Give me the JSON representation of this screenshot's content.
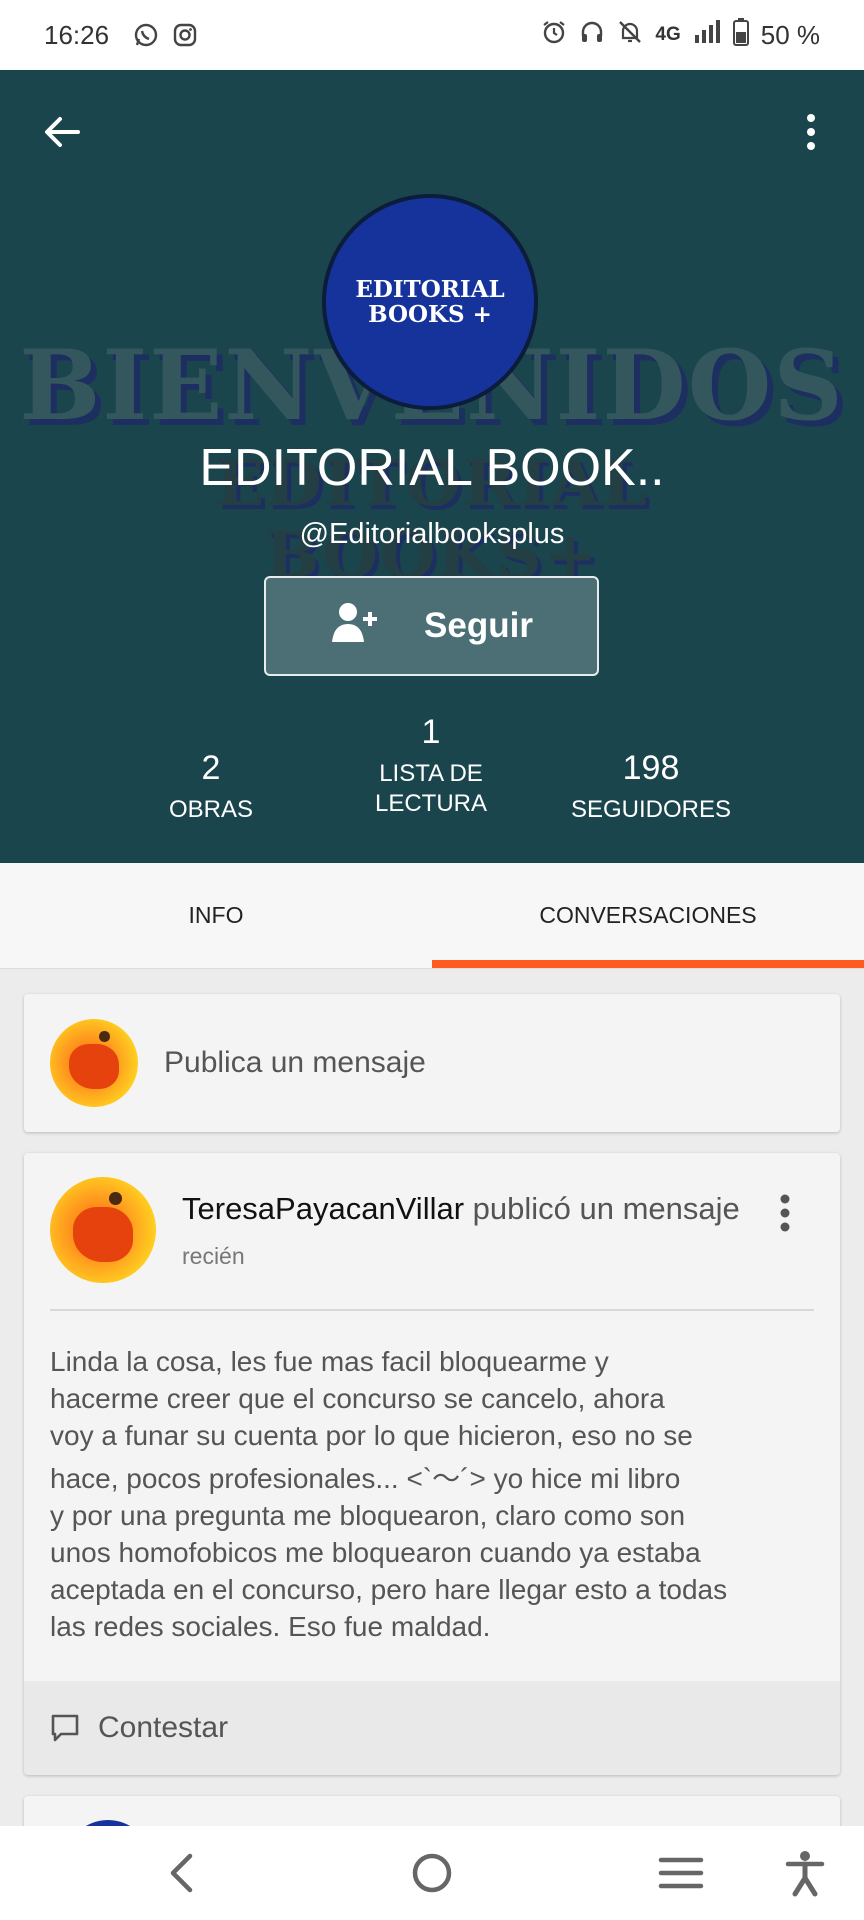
{
  "status_bar": {
    "time": "16:26",
    "network": "4G",
    "battery": "50 %",
    "left_icons": [
      "whatsapp-icon",
      "instagram-icon"
    ],
    "right_icons": [
      "alarm-icon",
      "headphones-icon",
      "mute-icon",
      "signal-icon",
      "battery-icon"
    ]
  },
  "header": {
    "background_color": "#1b454d",
    "banner_text": [
      "BIENVENIDOS",
      "EDITORIAL",
      "BOOKS+"
    ],
    "avatar_text": [
      "EDITORIAL",
      "BOOKS +"
    ],
    "avatar_color": "#15339a",
    "profile_name": "EDITORIAL BOOK..",
    "handle": "@Editorialbooksplus",
    "follow_label": "Seguir"
  },
  "stats": [
    {
      "value": "2",
      "label": "OBRAS"
    },
    {
      "value": "1",
      "label": "LISTA DE LECTURA"
    },
    {
      "value": "198",
      "label": "SEGUIDORES"
    }
  ],
  "tabs": [
    {
      "label": "INFO",
      "active": false
    },
    {
      "label": "CONVERSACIONES",
      "active": true
    }
  ],
  "accent_color": "#ff5a1f",
  "composer": {
    "placeholder": "Publica un mensaje"
  },
  "post": {
    "author": "TeresaPayacanVillar",
    "action": "publicó un mensaje",
    "time": "recién",
    "body_lines": [
      "Linda la cosa, les fue mas facil bloquearme y",
      "hacerme creer que el concurso se cancelo, ahora",
      "voy a funar su cuenta por lo que hicieron, eso no se",
      "hace, pocos profesionales... <`〜´> yo hice mi libro",
      "y por una pregunta me bloquearon, claro como son",
      "unos homofobicos me bloquearon cuando ya estaba",
      "aceptada en el concurso, pero hare llegar esto a todas",
      "las redes sociales. Eso fue maldad."
    ],
    "reply_label": "Contestar"
  }
}
